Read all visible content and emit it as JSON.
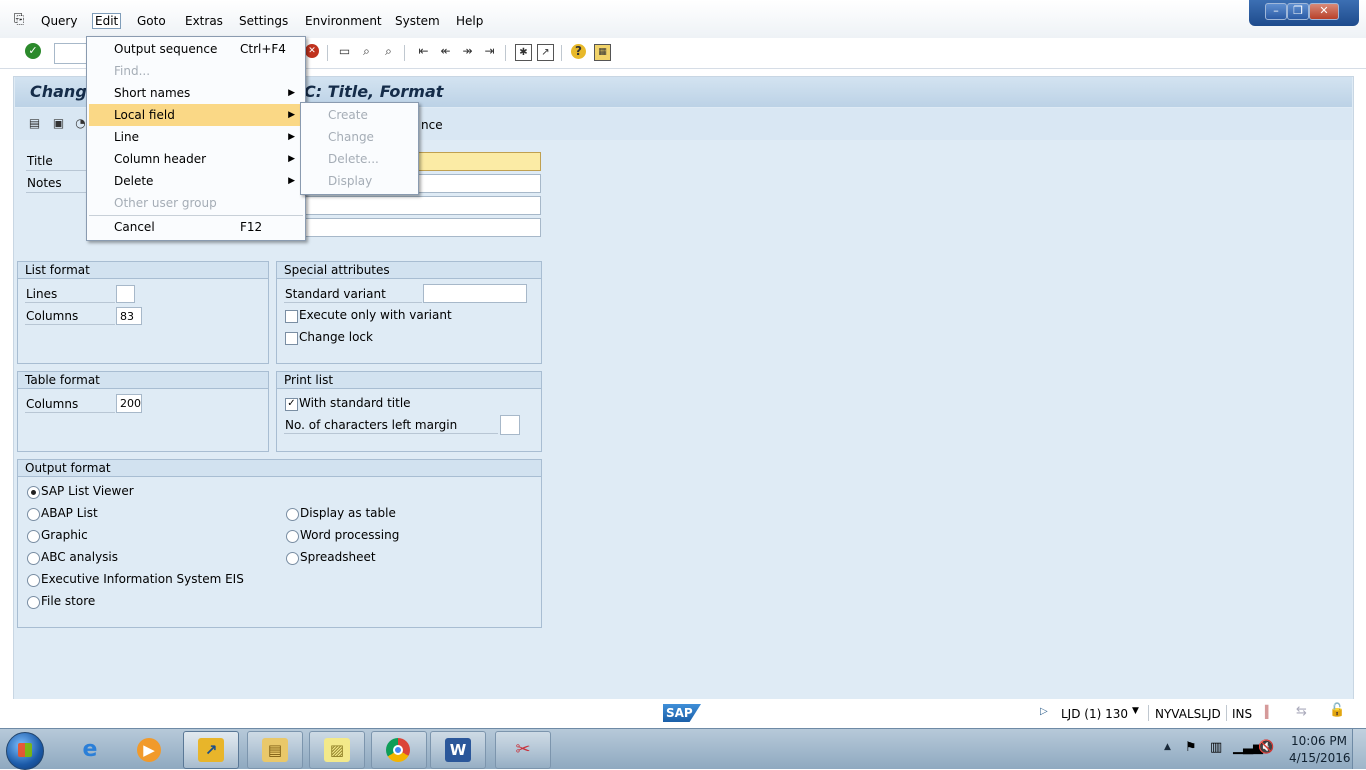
{
  "menubar": {
    "items": [
      "Query",
      "Edit",
      "Goto",
      "Extras",
      "Settings",
      "Environment",
      "System",
      "Help"
    ]
  },
  "window_controls": {
    "minimize": "–",
    "restore": "❐",
    "close": "✕"
  },
  "page_title_left": "Chang",
  "page_title_right": "IC: Title, Format",
  "app_toolbar_fragment": "nce",
  "fields": {
    "title_label": "Title",
    "notes_label": "Notes"
  },
  "list_format": {
    "header": "List format",
    "lines_label": "Lines",
    "lines_value": "",
    "columns_label": "Columns",
    "columns_value": "83"
  },
  "special_attributes": {
    "header": "Special attributes",
    "standard_variant_label": "Standard variant",
    "standard_variant_value": "",
    "execute_only_label": "Execute only with variant",
    "execute_only_checked": false,
    "change_lock_label": "Change lock",
    "change_lock_checked": false
  },
  "table_format": {
    "header": "Table format",
    "columns_label": "Columns",
    "columns_value": "200"
  },
  "print_list": {
    "header": "Print list",
    "standard_title_label": "With standard title",
    "standard_title_checked": true,
    "check_mark": "✓",
    "left_margin_label": "No. of characters left margin",
    "left_margin_value": ""
  },
  "output_format": {
    "header": "Output format",
    "options_left": [
      "SAP List Viewer",
      "ABAP List",
      "Graphic",
      "ABC analysis",
      "Executive Information System EIS",
      "File store"
    ],
    "options_right": [
      "Display as table",
      "Word processing",
      "Spreadsheet"
    ],
    "selected": "SAP List Viewer"
  },
  "edit_menu": {
    "items": [
      {
        "label": "Output sequence",
        "shortcut": "Ctrl+F4",
        "enabled": true,
        "submenu": false
      },
      {
        "label": "Find...",
        "shortcut": "",
        "enabled": false,
        "submenu": false
      },
      {
        "label": "Short names",
        "shortcut": "",
        "enabled": true,
        "submenu": true
      },
      {
        "label": "Local field",
        "shortcut": "",
        "enabled": true,
        "submenu": true,
        "highlighted": true
      },
      {
        "label": "Line",
        "shortcut": "",
        "enabled": true,
        "submenu": true
      },
      {
        "label": "Column header",
        "shortcut": "",
        "enabled": true,
        "submenu": true
      },
      {
        "label": "Delete",
        "shortcut": "",
        "enabled": true,
        "submenu": true
      },
      {
        "label": "Other user group",
        "shortcut": "",
        "enabled": false,
        "submenu": false
      },
      {
        "label": "Cancel",
        "shortcut": "F12",
        "enabled": true,
        "submenu": false
      }
    ]
  },
  "local_field_submenu": {
    "items": [
      {
        "label": "Create",
        "enabled": false
      },
      {
        "label": "Change",
        "enabled": false
      },
      {
        "label": "Delete...",
        "enabled": false
      },
      {
        "label": "Display",
        "enabled": false
      }
    ]
  },
  "statusbar": {
    "sap_logo": "SAP",
    "system": "LJD (1) 130",
    "server": "NYVALSLJD",
    "mode": "INS"
  },
  "taskbar": {
    "time": "10:06 PM",
    "date": "4/15/2016",
    "apps": [
      "Internet Explorer",
      "Windows Media Player",
      "SAP Logon",
      "Windows Explorer",
      "Sticky Notes",
      "Google Chrome",
      "Microsoft Word",
      "Snipping Tool"
    ]
  },
  "colors": {
    "menu_highlight": "#fad886",
    "panel_bg": "#dfebf5",
    "title_blue": "#152c49",
    "required_field": "#fbeba5"
  },
  "icons": [
    "layout-icon",
    "save-icon",
    "back-icon",
    "exit-icon",
    "cancel-icon",
    "print-icon",
    "find-icon",
    "find-next-icon",
    "first-page-icon",
    "previous-page-icon",
    "next-page-icon",
    "last-page-icon",
    "create-session-icon",
    "shortcut-icon",
    "help-icon",
    "customize-icon",
    "enter-icon"
  ]
}
